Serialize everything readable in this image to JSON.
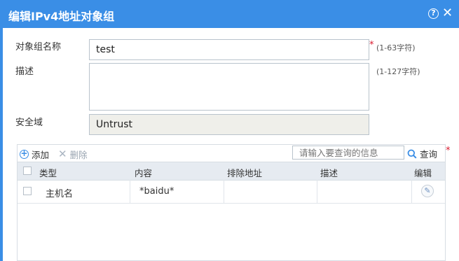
{
  "dialog": {
    "title": "编辑IPv4地址对象组",
    "help_glyph": "?",
    "close_glyph": "✕"
  },
  "form": {
    "name_label": "对象组名称",
    "name_value": "test",
    "name_hint": "(1-63字符)",
    "required_mark": "*",
    "desc_label": "描述",
    "desc_value": "",
    "desc_hint": "(1-127字符)",
    "zone_label": "安全域",
    "zone_value": "Untrust"
  },
  "toolbar": {
    "add_label": "添加",
    "delete_label": "删除",
    "search_placeholder": "请输入要查询的信息",
    "query_label": "查询",
    "required_mark": "*"
  },
  "table": {
    "columns": [
      "类型",
      "内容",
      "排除地址",
      "描述",
      "编辑"
    ],
    "rows": [
      {
        "type": "主机名",
        "content": "*baidu*",
        "exclude": "",
        "desc": ""
      }
    ]
  },
  "colors": {
    "accent": "#3a8ee6",
    "required": "#d9182d",
    "header_bg": "#e6ebf1"
  },
  "icons": [
    "help-icon",
    "close-icon",
    "add-icon",
    "delete-icon",
    "search-icon",
    "edit-icon"
  ]
}
